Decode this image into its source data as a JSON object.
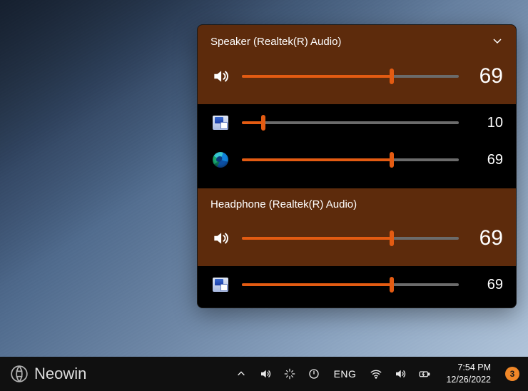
{
  "colors": {
    "accent": "#e35b12",
    "header_bg": "#5d2b0c"
  },
  "flyout": {
    "devices": [
      {
        "name": "Speaker (Realtek(R) Audio)",
        "master_volume": 69,
        "expanded": true,
        "apps": [
          {
            "icon": "system-sounds",
            "volume": 10
          },
          {
            "icon": "edge",
            "volume": 69
          }
        ]
      },
      {
        "name": "Headphone (Realtek(R) Audio)",
        "master_volume": 69,
        "expanded": false,
        "apps": [
          {
            "icon": "system-sounds",
            "volume": 69
          }
        ]
      }
    ]
  },
  "taskbar": {
    "brand": "Neowin",
    "language": "ENG",
    "time": "7:54 PM",
    "date": "12/26/2022",
    "notifications": 3
  }
}
